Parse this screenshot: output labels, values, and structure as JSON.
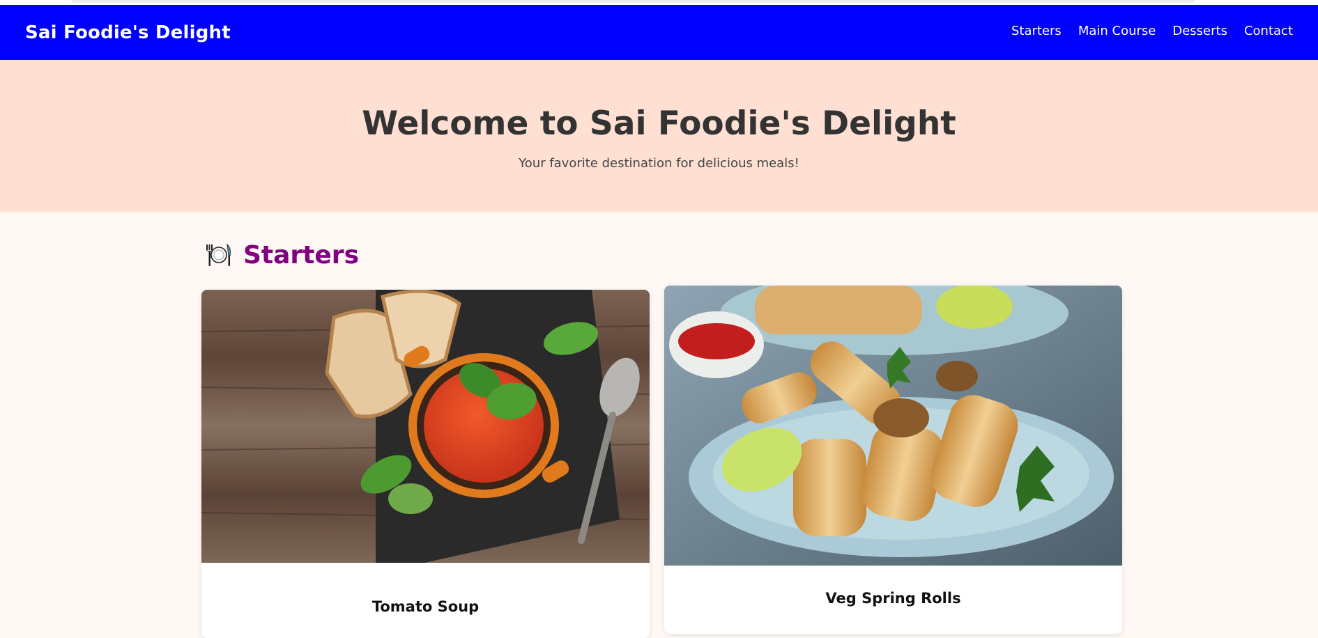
{
  "brand": "Sai Foodie's Delight",
  "nav": {
    "items": [
      "Starters",
      "Main Course",
      "Desserts",
      "Contact"
    ]
  },
  "hero": {
    "title": "Welcome to Sai Foodie's Delight",
    "subtitle": "Your favorite destination for delicious meals!"
  },
  "section": {
    "icon": "plate-with-cutlery-icon",
    "title": "Starters"
  },
  "cards": [
    {
      "title": "Tomato Soup",
      "image": "tomato-soup-photo"
    },
    {
      "title": "Veg Spring Rolls",
      "image": "veg-spring-rolls-photo"
    }
  ],
  "colors": {
    "navbar": "#0000ff",
    "hero_bg": "#ffe0d3",
    "page_bg": "#fff8f4",
    "section_title": "#800080"
  }
}
